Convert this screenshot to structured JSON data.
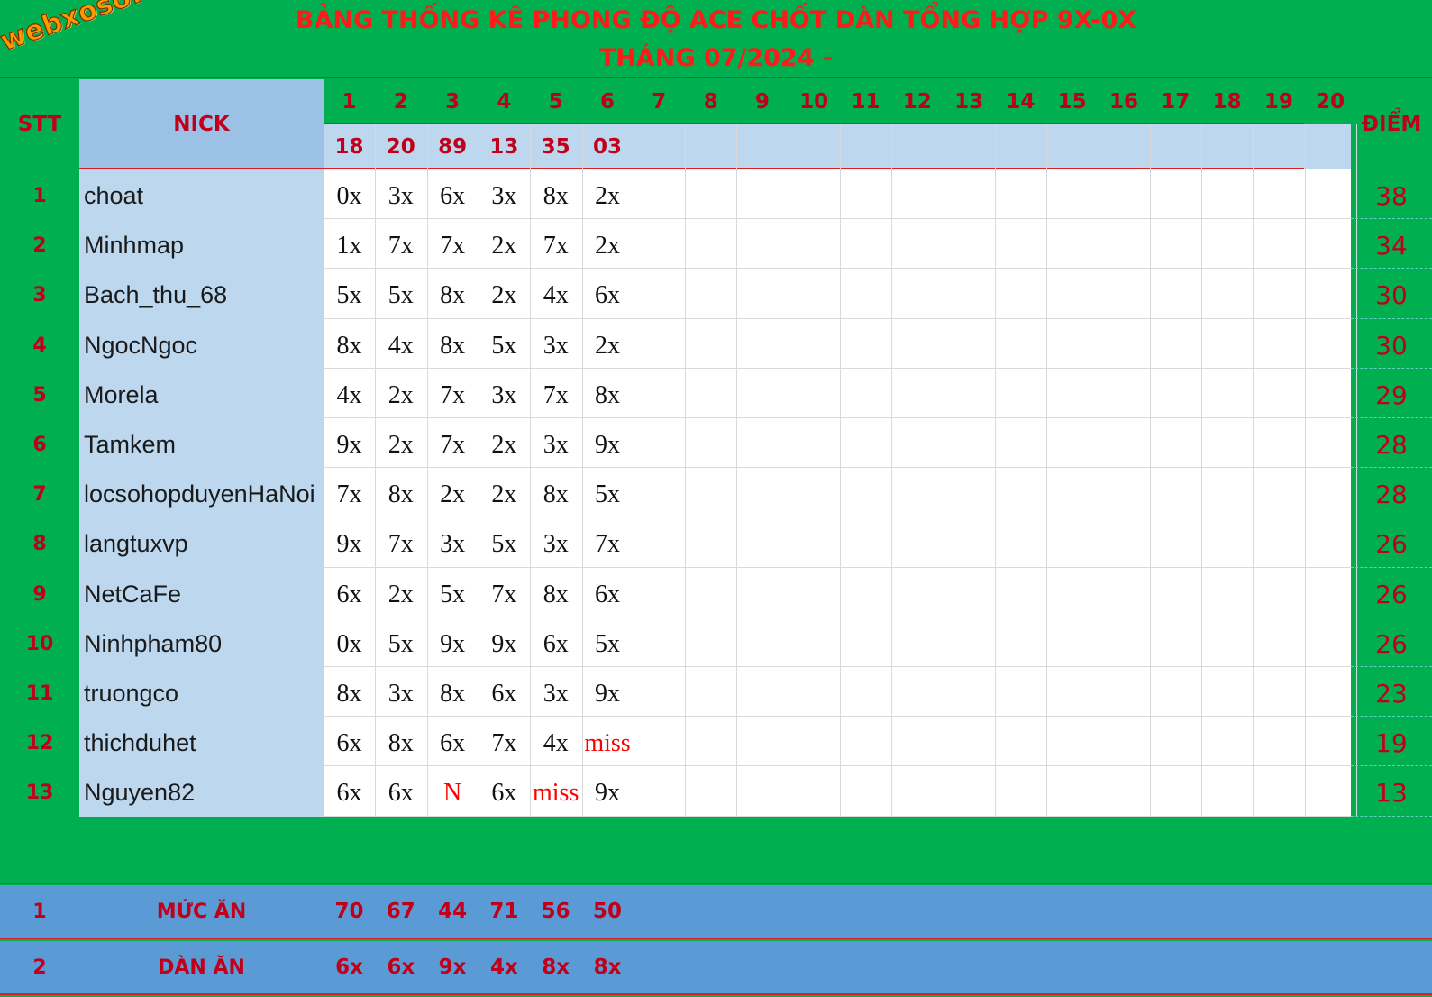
{
  "title_line1": "BẢNG THỐNG KÊ PHONG ĐỘ ACE CHỐT DÀN TỔNG HỢP 9X-0X",
  "title_line2": "THÁNG 07/2024 -",
  "logo_text": "webxoso.net",
  "headers": {
    "stt": "STT",
    "nick": "NICK",
    "diem": "ĐIỂM"
  },
  "days": [
    "1",
    "2",
    "3",
    "4",
    "5",
    "6",
    "7",
    "8",
    "9",
    "10",
    "11",
    "12",
    "13",
    "14",
    "15",
    "16",
    "17",
    "18",
    "19",
    "20"
  ],
  "day_results": [
    "18",
    "20",
    "89",
    "13",
    "35",
    "03"
  ],
  "rows": [
    {
      "stt": "1",
      "nick": "choat",
      "picks": [
        "0x",
        "3x",
        "6x",
        "3x",
        "8x",
        "2x"
      ],
      "diem": "38"
    },
    {
      "stt": "2",
      "nick": "Minhmap",
      "picks": [
        "1x",
        "7x",
        "7x",
        "2x",
        "7x",
        "2x"
      ],
      "diem": "34"
    },
    {
      "stt": "3",
      "nick": "Bach_thu_68",
      "picks": [
        "5x",
        "5x",
        "8x",
        "2x",
        "4x",
        "6x"
      ],
      "diem": "30"
    },
    {
      "stt": "4",
      "nick": "NgocNgoc",
      "picks": [
        "8x",
        "4x",
        "8x",
        "5x",
        "3x",
        "2x"
      ],
      "diem": "30"
    },
    {
      "stt": "5",
      "nick": "Morela",
      "picks": [
        "4x",
        "2x",
        "7x",
        "3x",
        "7x",
        "8x"
      ],
      "diem": "29"
    },
    {
      "stt": "6",
      "nick": "Tamkem",
      "picks": [
        "9x",
        "2x",
        "7x",
        "2x",
        "3x",
        "9x"
      ],
      "diem": "28"
    },
    {
      "stt": "7",
      "nick": "locsohopduyenHaNoi",
      "picks": [
        "7x",
        "8x",
        "2x",
        "2x",
        "8x",
        "5x"
      ],
      "diem": "28"
    },
    {
      "stt": "8",
      "nick": "langtuxvp",
      "picks": [
        "9x",
        "7x",
        "3x",
        "5x",
        "3x",
        "7x"
      ],
      "diem": "26"
    },
    {
      "stt": "9",
      "nick": "NetCaFe",
      "picks": [
        "6x",
        "2x",
        "5x",
        "7x",
        "8x",
        "6x"
      ],
      "diem": "26"
    },
    {
      "stt": "10",
      "nick": "Ninhpham80",
      "picks": [
        "0x",
        "5x",
        "9x",
        "9x",
        "6x",
        "5x"
      ],
      "diem": "26"
    },
    {
      "stt": "11",
      "nick": "truongco",
      "picks": [
        "8x",
        "3x",
        "8x",
        "6x",
        "3x",
        "9x"
      ],
      "diem": "23"
    },
    {
      "stt": "12",
      "nick": "thichduhet",
      "picks": [
        "6x",
        "8x",
        "6x",
        "7x",
        "4x",
        "miss"
      ],
      "diem": "19"
    },
    {
      "stt": "13",
      "nick": "Nguyen82",
      "picks": [
        "6x",
        "6x",
        "N",
        "6x",
        "miss",
        "9x"
      ],
      "diem": "13"
    }
  ],
  "footer": [
    {
      "stt": "1",
      "label": "MỨC ĂN",
      "values": [
        "70",
        "67",
        "44",
        "71",
        "56",
        "50"
      ]
    },
    {
      "stt": "2",
      "label": "DÀN ĂN",
      "values": [
        "6x",
        "6x",
        "9x",
        "4x",
        "8x",
        "8x"
      ]
    }
  ],
  "colors": {
    "green_bg": "#00b050",
    "title_red": "#ff1a1a",
    "header_red": "#c0001b",
    "nick_blue": "#bdd7ee",
    "footer_blue": "#5b9bd5",
    "miss_red": "#ff0000"
  }
}
